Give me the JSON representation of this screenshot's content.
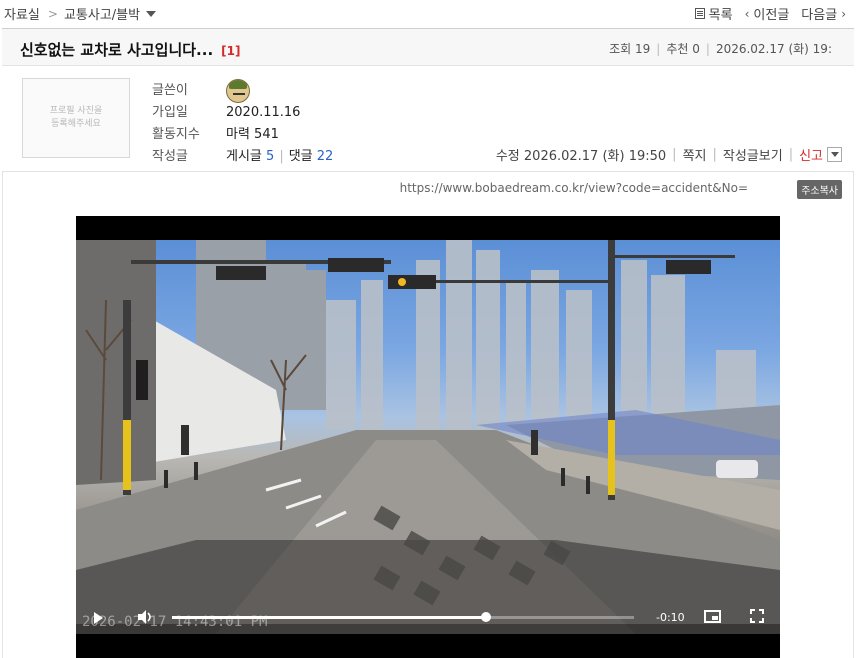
{
  "breadcrumb": {
    "root": "자료실",
    "sep": ">",
    "board": "교통사고/블박"
  },
  "nav": {
    "list": "목록",
    "prev": "이전글",
    "next": "다음글"
  },
  "post": {
    "title": "신호없는 교차로 사고입니다...",
    "comment_count": "[1]",
    "views_label": "조회",
    "views": "19",
    "recommend_label": "추천",
    "recommend": "0",
    "date": "2026.02.17 (화) 19:"
  },
  "author": {
    "profile_placeholder_line1": "프로필 사진을",
    "profile_placeholder_line2": "등록해주세요",
    "label_writer": "글쓴이",
    "label_joined": "가입일",
    "label_activity": "활동지수",
    "label_posts": "작성글",
    "joined": "2020.11.16",
    "activity": "마력 541",
    "posts_label": "게시글",
    "posts_count": "5",
    "comments_label": "댓글",
    "comments_count": "22"
  },
  "actions": {
    "edited": "수정 2026.02.17 (화) 19:50",
    "message": "쪽지",
    "view_posts": "작성글보기",
    "report": "신고"
  },
  "url_line": {
    "url": "https://www.bobaedream.co.kr/view?code=accident&No=",
    "copy": "주소복사"
  },
  "video": {
    "timestamp": "2026-02-17 14:43:01 PM",
    "remaining": "-0:10",
    "progress": 0.68
  }
}
